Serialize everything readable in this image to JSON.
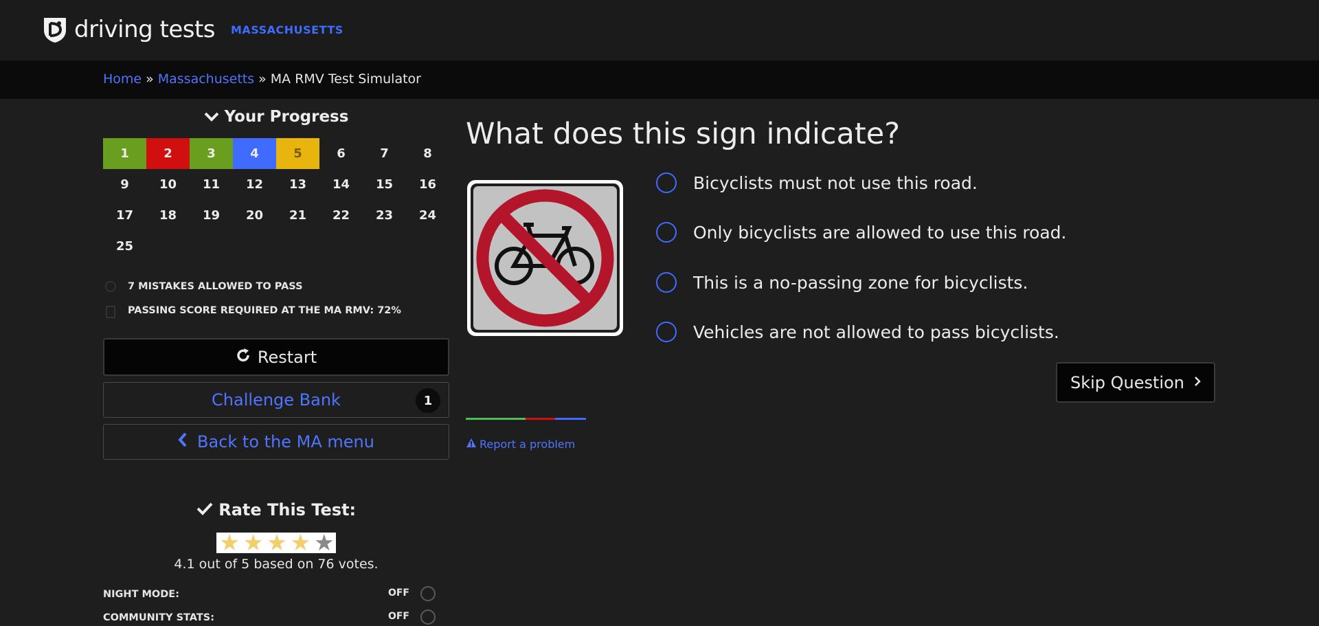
{
  "header": {
    "logo_text": "driving tests",
    "state": "MASSACHUSETTS"
  },
  "breadcrumb": {
    "home": "Home",
    "sep": "»",
    "state": "Massachusetts",
    "current": "MA RMV Test Simulator"
  },
  "progress": {
    "title": "Your Progress",
    "cells": [
      {
        "n": "1",
        "status": "correct"
      },
      {
        "n": "2",
        "status": "wrong"
      },
      {
        "n": "3",
        "status": "correct"
      },
      {
        "n": "4",
        "status": "current"
      },
      {
        "n": "5",
        "status": "skipped"
      },
      {
        "n": "6"
      },
      {
        "n": "7"
      },
      {
        "n": "8"
      },
      {
        "n": "9"
      },
      {
        "n": "10"
      },
      {
        "n": "11"
      },
      {
        "n": "12"
      },
      {
        "n": "13"
      },
      {
        "n": "14"
      },
      {
        "n": "15"
      },
      {
        "n": "16"
      },
      {
        "n": "17"
      },
      {
        "n": "18"
      },
      {
        "n": "19"
      },
      {
        "n": "20"
      },
      {
        "n": "21"
      },
      {
        "n": "22"
      },
      {
        "n": "23"
      },
      {
        "n": "24"
      },
      {
        "n": "25"
      }
    ]
  },
  "info": {
    "mistakes": "7 MISTAKES ALLOWED TO PASS",
    "passing": "PASSING SCORE REQUIRED AT THE MA RMV: 72%"
  },
  "buttons": {
    "restart": "Restart",
    "challenge": "Challenge Bank",
    "challenge_count": "1",
    "back": "Back to the MA menu"
  },
  "rating": {
    "title": "Rate This Test:",
    "votes_text": "4.1 out of 5 based on 76 votes.",
    "value": 4.1,
    "max": 5
  },
  "toggles": [
    {
      "label": "NIGHT MODE:",
      "value": "OFF"
    },
    {
      "label": "COMMUNITY STATS:",
      "value": "OFF"
    }
  ],
  "question": {
    "text": "What does this sign indicate?",
    "sign_icon": "no-bicycles-sign",
    "answers": [
      "Bicyclists must not use this road.",
      "Only bicyclists are allowed to use this road.",
      "This is a no-passing zone for bicyclists.",
      "Vehicles are not allowed to pass bicyclists."
    ]
  },
  "skip": "Skip Question",
  "colors": {
    "correct": "#6a9e1f",
    "wrong": "#d10f0f",
    "current": "#3f6cff",
    "skipped": "#e8b50e",
    "accent": "#3f6cff"
  },
  "report": "Report a problem"
}
